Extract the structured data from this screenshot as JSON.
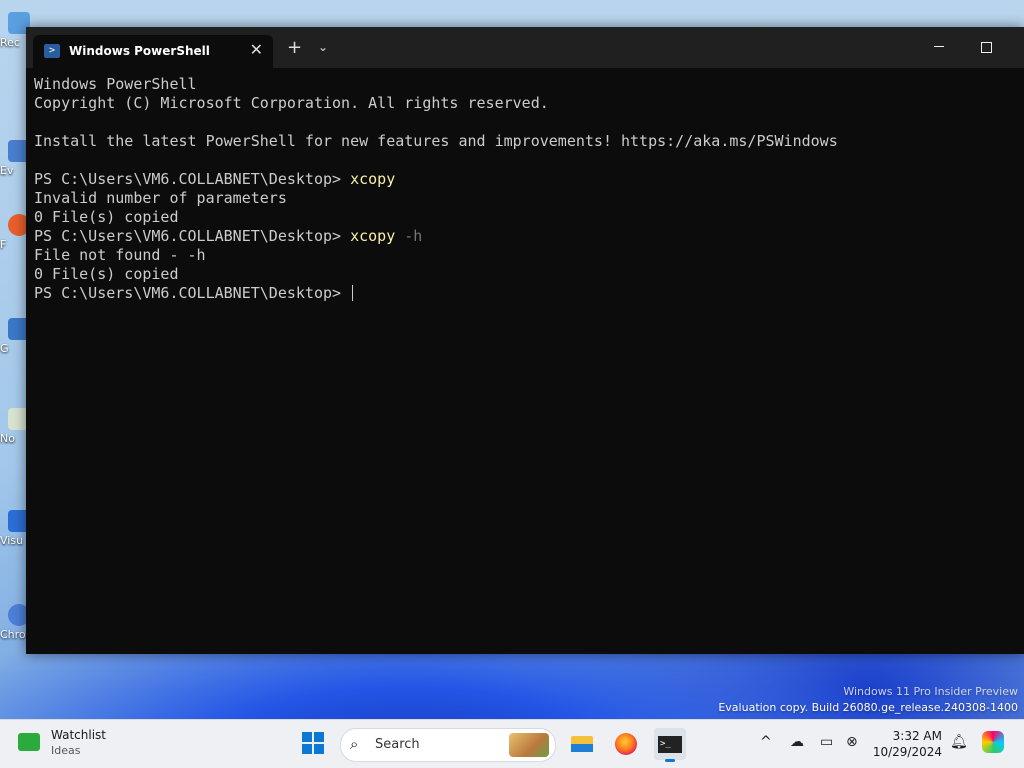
{
  "window": {
    "tab_title": "Windows PowerShell",
    "close_glyph": "✕",
    "newtab_glyph": "+",
    "dropdown_glyph": "⌄"
  },
  "terminal": {
    "lines": [
      {
        "text": "Windows PowerShell"
      },
      {
        "text": "Copyright (C) Microsoft Corporation. All rights reserved."
      },
      {
        "text": ""
      },
      {
        "text": "Install the latest PowerShell for new features and improvements! https://aka.ms/PSWindows"
      },
      {
        "text": ""
      },
      {
        "prompt": "PS C:\\Users\\VM6.COLLABNET\\Desktop> ",
        "cmd": "xcopy",
        "arg": ""
      },
      {
        "text": "Invalid number of parameters"
      },
      {
        "text": "0 File(s) copied"
      },
      {
        "prompt": "PS C:\\Users\\VM6.COLLABNET\\Desktop> ",
        "cmd": "xcopy",
        "arg": " -h"
      },
      {
        "text": "File not found - -h"
      },
      {
        "text": "0 File(s) copied"
      },
      {
        "prompt": "PS C:\\Users\\VM6.COLLABNET\\Desktop> ",
        "cmd": "",
        "arg": "",
        "cursor": true
      }
    ],
    "colors": {
      "background": "#0c0c0c",
      "text": "#cccccc",
      "command": "#f9f1a5",
      "argument": "#767676"
    }
  },
  "desktop": {
    "icons": [
      "Rec",
      "Ev",
      "F",
      "G",
      "No",
      "Visu",
      "Chromium"
    ],
    "watermark_line1": "Windows 11 Pro Insider Preview",
    "watermark_line2": "Evaluation copy. Build 26080.ge_release.240308-1400"
  },
  "taskbar": {
    "widget_title": "Watchlist",
    "widget_subtitle": "Ideas",
    "search_label": "Search",
    "search_icon": "⌕",
    "apps": [
      "folder-icon",
      "firefox-icon",
      "terminal-icon"
    ],
    "tray": {
      "chevron": "^",
      "time": "3:32 AM",
      "date": "10/29/2024"
    }
  }
}
